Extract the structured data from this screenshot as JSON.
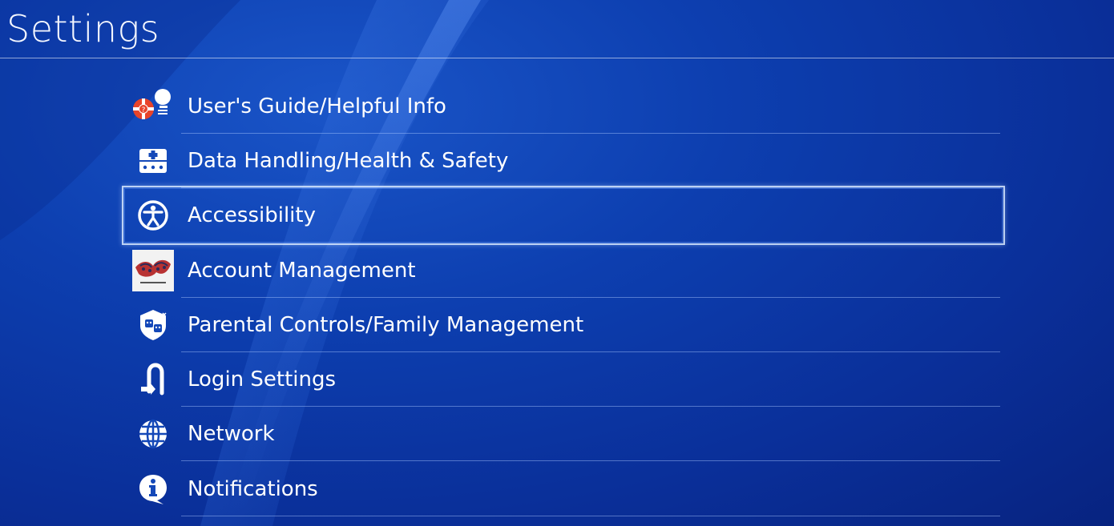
{
  "header": {
    "title": "Settings"
  },
  "menu": {
    "items": [
      {
        "label": "User's Guide/Helpful Info",
        "icon": "help-lightbulb-icon"
      },
      {
        "label": "Data Handling/Health & Safety",
        "icon": "first-aid-icon"
      },
      {
        "label": "Accessibility",
        "icon": "accessibility-icon",
        "selected": true
      },
      {
        "label": "Account Management",
        "icon": "account-avatar"
      },
      {
        "label": "Parental Controls/Family Management",
        "icon": "parental-controls-icon"
      },
      {
        "label": "Login Settings",
        "icon": "login-icon"
      },
      {
        "label": "Network",
        "icon": "globe-icon"
      },
      {
        "label": "Notifications",
        "icon": "info-icon"
      }
    ]
  },
  "colors": {
    "background": "#0d3fb0",
    "text": "#ffffff",
    "selection_border": "#dcebff"
  }
}
